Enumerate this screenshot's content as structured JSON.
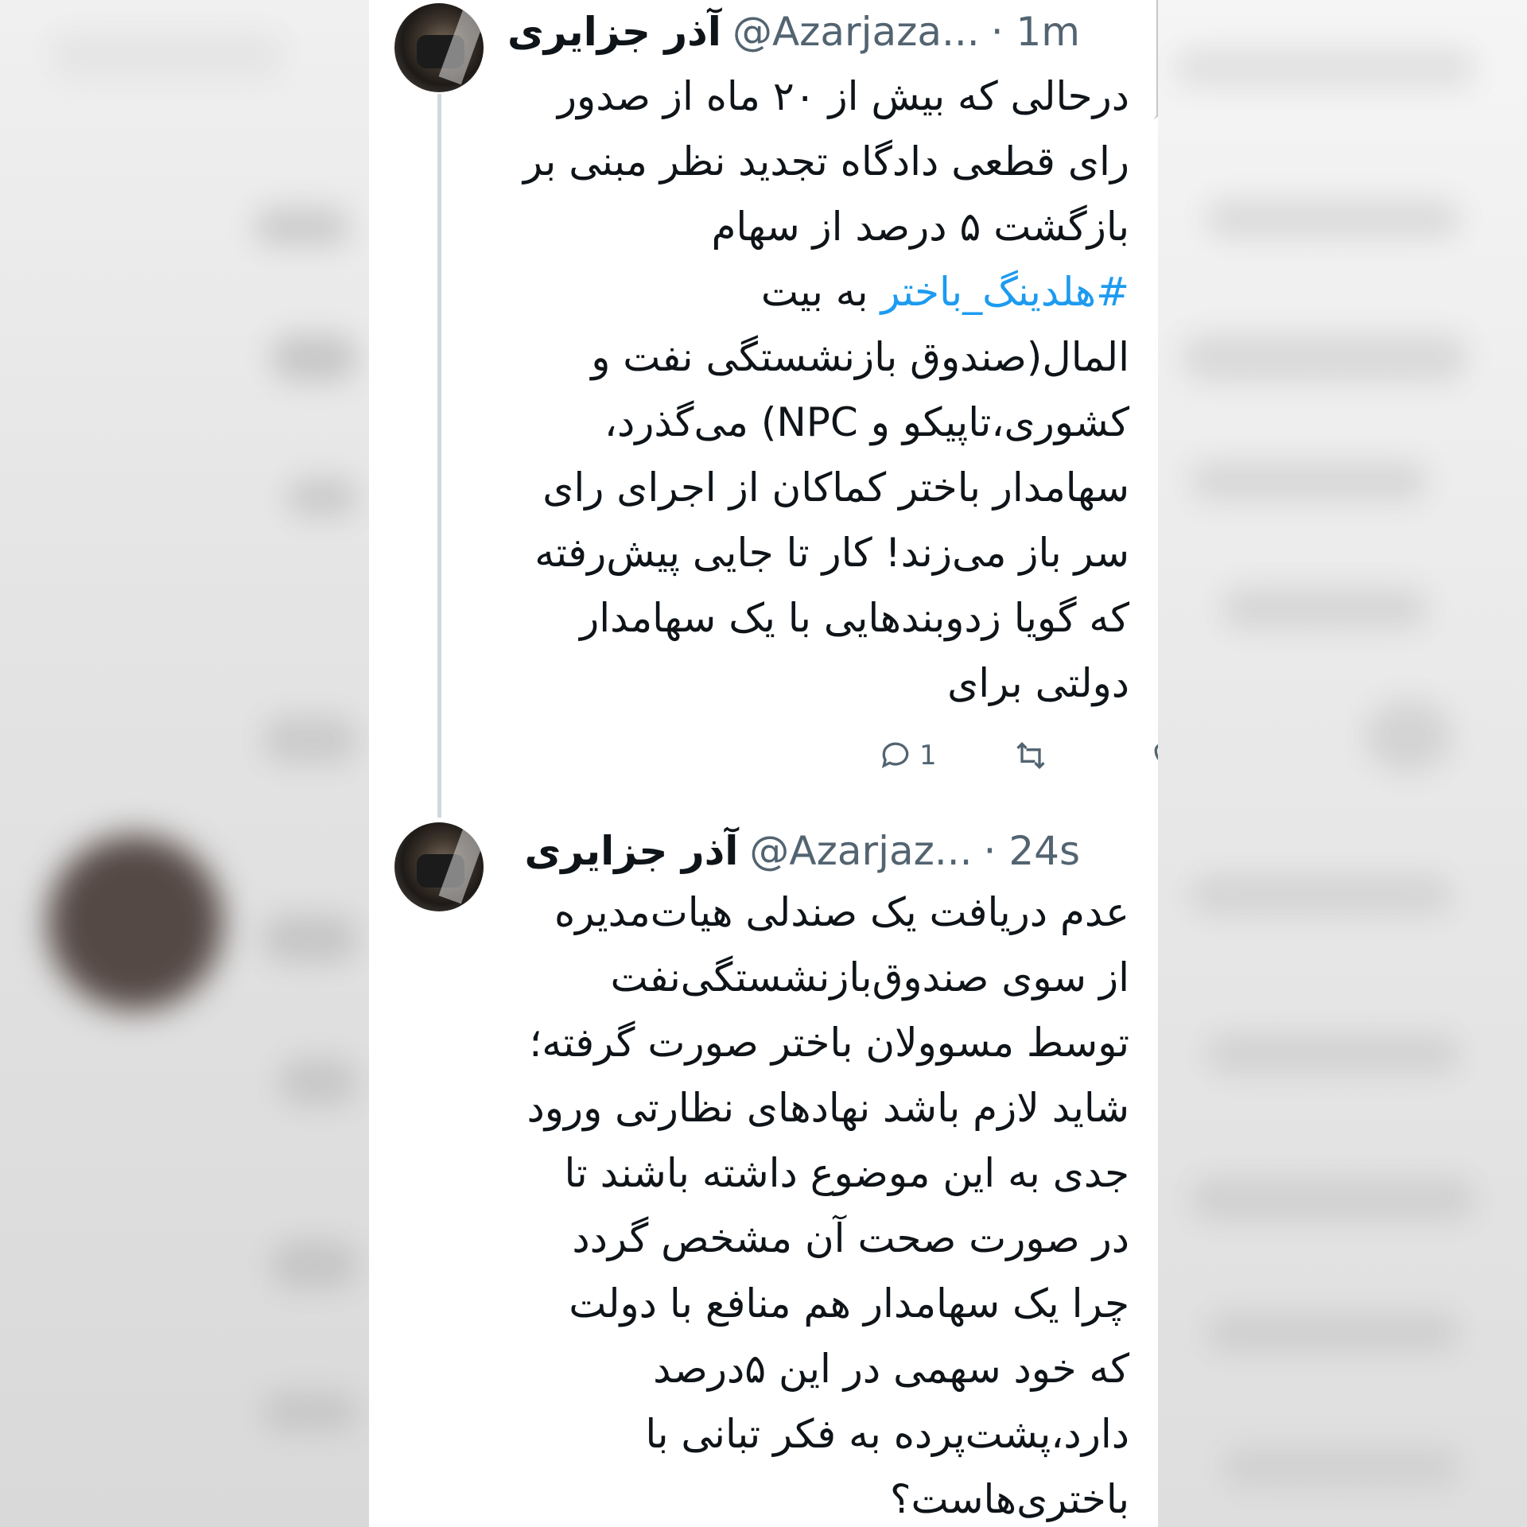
{
  "tweets": [
    {
      "name": "آذر جزایری",
      "handle": "@Azarjaza...",
      "time": "· 1m",
      "lines": [
        "درحالی که بیش از ۲۰ ماه از صدور",
        "رای قطعی دادگاه تجدید نظر مبنی بر",
        "بازگشت ۵ درصد از سهام",
        "",
        "المال(صندوق بازنشستگی نفت و",
        "کشوری،تاپیکو و NPC) می‌گذرد،",
        "سهامدار باختر کماکان از اجرای رای",
        "سر باز می‌زند! کار تا جایی پیش‌رفته",
        "که گویا زدوبندهایی با یک سهامدار",
        "دولتی برای"
      ],
      "hashtag": "#هلدینگ_باختر",
      "hashtag_suffix": " به بیت",
      "reply_count": "1",
      "icons": {
        "reply": "reply-icon",
        "retweet": "retweet-icon",
        "like": "heart-icon",
        "views": "views-icon",
        "share": "share-icon",
        "more": "more-icon"
      }
    },
    {
      "name": "آذر جزایری",
      "handle": "@Azarjaz...",
      "time": "· 24s",
      "lines": [
        "عدم دریافت یک صندلی هیات‌مدیره",
        "از سوی صندوق‌بازنشستگی‌نفت",
        "توسط مسوولان باختر صورت گرفته؛",
        "شاید لازم باشد نهادهای نظارتی ورود",
        "جدی به این موضوع داشته باشند تا",
        "در صورت صحت آن مشخص گردد",
        "چرا یک سهامدار هم منافع با دولت",
        "که خود سهمی در این ۵درصد",
        "دارد،پشت‌پرده به فکر تبانی با",
        "باختری‌هاست؟"
      ]
    }
  ],
  "colors": {
    "hashtag": "#1d9bf0",
    "text": "#0f1419",
    "muted": "#536471"
  }
}
